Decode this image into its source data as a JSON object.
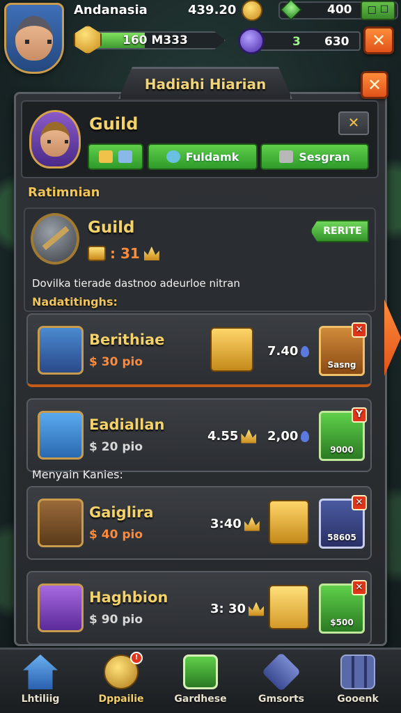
{
  "hud": {
    "player_name": "Andanasia",
    "gold": "439.20",
    "gems": "400",
    "plus_label": "□ ☐",
    "xp_text": "160 M333",
    "energy_a": "3",
    "energy_b": "630",
    "xp_fraction": 0.42
  },
  "panel": {
    "title": "Hadiahi Hiarian",
    "close_label": "✕"
  },
  "guild_header": {
    "name": "Guild",
    "close_label": "✕",
    "btn_b": "Fuldamk",
    "btn_c": "Sesgran"
  },
  "section_label": "Ratimnian",
  "quest": {
    "title": "Guild",
    "reward": ": 31",
    "tag": "RERITE",
    "description": "Dovilka tierade dastnoo adeurloe nitran",
    "sub_label": "Nadatitinghs:"
  },
  "between_label": "Menyain Kanies:",
  "items": [
    {
      "name": "Berithiae",
      "price": "$ 30 pio",
      "qty": "7.40",
      "action": "Sasng",
      "badge": "✕"
    },
    {
      "name": "Eadiallan",
      "price": "$ 20 pio",
      "qty_left": "4.55",
      "qty": "2,00",
      "action": "9000",
      "badge": "Y"
    },
    {
      "name": "Gaiglira",
      "price": "$ 40 pio",
      "qty_left": "3:40",
      "action": "58605",
      "badge": "✕"
    },
    {
      "name": "Haghbion",
      "price": "$ 90 pio",
      "qty_left": "3: 30",
      "action": "$500",
      "badge": "✕"
    }
  ],
  "nav": [
    {
      "label": "Lhtiliig",
      "icon": "house-icon"
    },
    {
      "label": "Dppailie",
      "icon": "gold-chest-icon",
      "badge": "!"
    },
    {
      "label": "Gardhese",
      "icon": "shield-icon"
    },
    {
      "label": "Gmsorts",
      "icon": "crystal-icon"
    },
    {
      "label": "Gooenk",
      "icon": "grid-icon"
    }
  ],
  "colors": {
    "accent_gold": "#f3d16b",
    "accent_orange": "#e0521a",
    "accent_green": "#3f9a32"
  }
}
